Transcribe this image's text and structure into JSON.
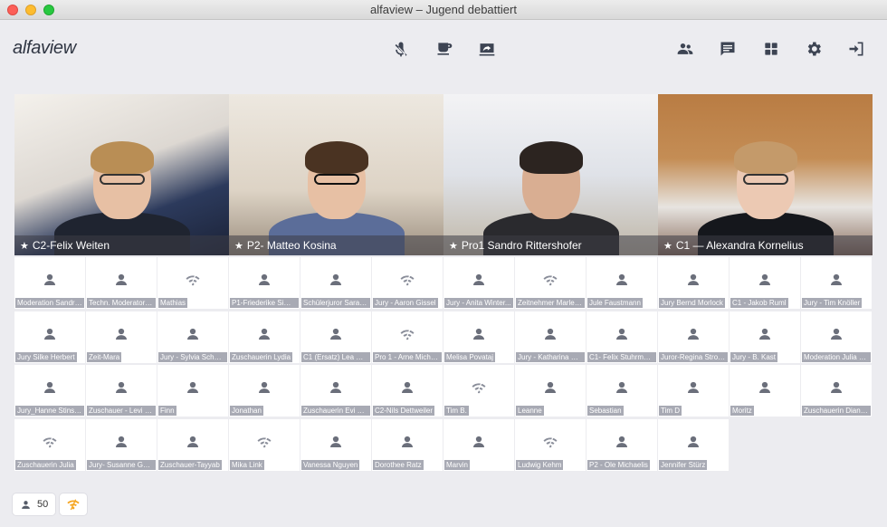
{
  "window": {
    "title": "alfaview – Jugend debattiert"
  },
  "toolbar": {
    "logo": "alfaview",
    "center_buttons": [
      {
        "icon": "mic-off-icon"
      },
      {
        "icon": "coffee-icon"
      },
      {
        "icon": "screen-share-icon"
      }
    ],
    "right_buttons": [
      {
        "icon": "participants-icon"
      },
      {
        "icon": "chat-icon"
      },
      {
        "icon": "layout-grid-icon"
      },
      {
        "icon": "settings-gear-icon"
      },
      {
        "icon": "exit-icon"
      }
    ]
  },
  "videos": [
    {
      "label": "C2-Felix Weiten",
      "starred": true
    },
    {
      "label": "P2- Matteo Kosina",
      "starred": true
    },
    {
      "label": "Pro1 Sandro Rittershofer",
      "starred": true
    },
    {
      "label": "C1 — Alexandra Kornelius",
      "starred": true
    }
  ],
  "participants": [
    {
      "name": "Moderation Sandra...",
      "icon": "user"
    },
    {
      "name": "Techn. Moderator F...",
      "icon": "user"
    },
    {
      "name": "Mathias",
      "icon": "wifi"
    },
    {
      "name": "P1-Friederike Sima...",
      "icon": "user"
    },
    {
      "name": "Schülerjuror Sarah ...",
      "icon": "user"
    },
    {
      "name": "Jury - Aaron Gissel",
      "icon": "wifi"
    },
    {
      "name": "Jury - Anita Winter...",
      "icon": "user"
    },
    {
      "name": "Zeitnehmer Marlen...",
      "icon": "wifi"
    },
    {
      "name": "Jule Faustmann",
      "icon": "user"
    },
    {
      "name": "Jury Bernd Morlock",
      "icon": "user"
    },
    {
      "name": "C1 - Jakob Ruml",
      "icon": "user"
    },
    {
      "name": "Jury - Tim Knöller",
      "icon": "user"
    },
    {
      "name": "Jury Silke Herbert",
      "icon": "user"
    },
    {
      "name": "Zeit-Mara",
      "icon": "user"
    },
    {
      "name": "Jury - Sylvia Schäfer",
      "icon": "user"
    },
    {
      "name": "Zuschauerin Lydia",
      "icon": "user"
    },
    {
      "name": "C1 (Ersatz) Lea Gat...",
      "icon": "user"
    },
    {
      "name": "Pro 1 - Arne Michae...",
      "icon": "wifi"
    },
    {
      "name": "Melisa Povataj",
      "icon": "user"
    },
    {
      "name": "Jury - Katharina Sp...",
      "icon": "user"
    },
    {
      "name": "C1- Felix Stuhrmann",
      "icon": "user"
    },
    {
      "name": "Juror-Regina Strob...",
      "icon": "user"
    },
    {
      "name": "Jury - B. Kast",
      "icon": "user"
    },
    {
      "name": "Moderation Julia V...",
      "icon": "user"
    },
    {
      "name": "Jury_Hanne Stinsh...",
      "icon": "user"
    },
    {
      "name": "Zuschauer - Levi K...",
      "icon": "user"
    },
    {
      "name": "Finn",
      "icon": "user"
    },
    {
      "name": "Jonathan",
      "icon": "user"
    },
    {
      "name": "Zuschauerin Evi He...",
      "icon": "user"
    },
    {
      "name": "C2-Nils Dettweiler",
      "icon": "user"
    },
    {
      "name": "Tim B.",
      "icon": "wifi"
    },
    {
      "name": "Leanne",
      "icon": "user"
    },
    {
      "name": "Sebastian",
      "icon": "user"
    },
    {
      "name": "Tim D",
      "icon": "user"
    },
    {
      "name": "Moritz",
      "icon": "user"
    },
    {
      "name": "Zuschauerin Diana ...",
      "icon": "user"
    },
    {
      "name": "Zuschauerin Julia",
      "icon": "wifi"
    },
    {
      "name": "Jury- Susanne Ger...",
      "icon": "user"
    },
    {
      "name": "Zuschauer-Tayyab",
      "icon": "user"
    },
    {
      "name": "Mika Link",
      "icon": "wifi"
    },
    {
      "name": "Vanessa Nguyen",
      "icon": "user"
    },
    {
      "name": "Dorothee Ratz",
      "icon": "user"
    },
    {
      "name": "Marvin",
      "icon": "user"
    },
    {
      "name": "Ludwig Kehm",
      "icon": "wifi"
    },
    {
      "name": "P2 - Ole Michaelis",
      "icon": "user"
    },
    {
      "name": "Jennifer Stürz",
      "icon": "user"
    }
  ],
  "footer": {
    "participant_count": "50",
    "network_icon": "network-quality-icon"
  },
  "colors": {
    "accent": "#f5a623",
    "icon": "#6b6f7b",
    "label_bg": "#a8aab4"
  }
}
